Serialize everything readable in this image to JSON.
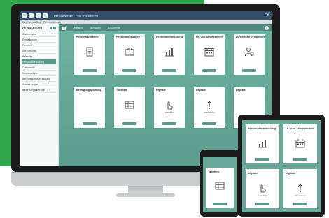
{
  "desktop": {
    "topbar": {
      "address": "Personalwesen · Fibu · Hauptmenü",
      "brand": "FM"
    },
    "subbar": {
      "breadcrumb": "Start · Verwaltung · Personalbereich"
    },
    "sidebar": {
      "title": "Verwaltungen",
      "items": [
        "Stammdaten",
        "Einstellungen",
        "Personal",
        "Abrechnung",
        "Kalender",
        "Personalverwaltung",
        "Dokumente",
        "Vorgangstypen",
        "Berechtigungsverwaltung",
        "Auswertungen",
        "Bewertungsübersicht"
      ],
      "active_index": 5
    },
    "toolbar": {
      "labels": [
        "Übersicht",
        "Aufgaben",
        "Dokumente"
      ]
    },
    "tiles_row1": [
      {
        "title": "Personalposteien",
        "icon": "document-icon"
      },
      {
        "title": "Personalausgaben",
        "icon": "wallet-icon"
      },
      {
        "title": "Personalentwicklung",
        "icon": "chart-icon"
      },
      {
        "title": "Ur- und Abwesenheit",
        "icon": "calendar-icon"
      },
      {
        "title": "Dienstliche Verwaltung",
        "icon": "person-icon"
      }
    ],
    "tiles_row2": [
      {
        "title": "Bewegungsplanung",
        "icon": "",
        "sub": ""
      },
      {
        "title": "Tabellen",
        "icon": "table-icon",
        "sub": ""
      },
      {
        "title": "Digitale",
        "icon": "hand-icon",
        "sub": "Ausfüllen"
      },
      {
        "title": "Digitale",
        "icon": "upload-icon",
        "sub": "Überweisen"
      },
      {
        "title": "Digitale",
        "icon": "",
        "sub": ""
      }
    ]
  },
  "tablet": {
    "tiles": [
      {
        "title": "Personalentwicklung",
        "icon": "chart-icon",
        "sub": ""
      },
      {
        "title": "Ur- und Abwesenheit",
        "icon": "calendar-icon",
        "sub": ""
      },
      {
        "title": "Digitale",
        "icon": "hand-icon",
        "sub": "Ausfüllen"
      },
      {
        "title": "Digitale",
        "icon": "upload-icon",
        "sub": "Überweisen"
      }
    ]
  },
  "phone": {
    "tile": {
      "title": "Tabellen",
      "icon": "table-icon"
    }
  },
  "colors": {
    "brand_green": "#2ea84a",
    "teal": "#6aa999",
    "topbar": "#34506a"
  }
}
